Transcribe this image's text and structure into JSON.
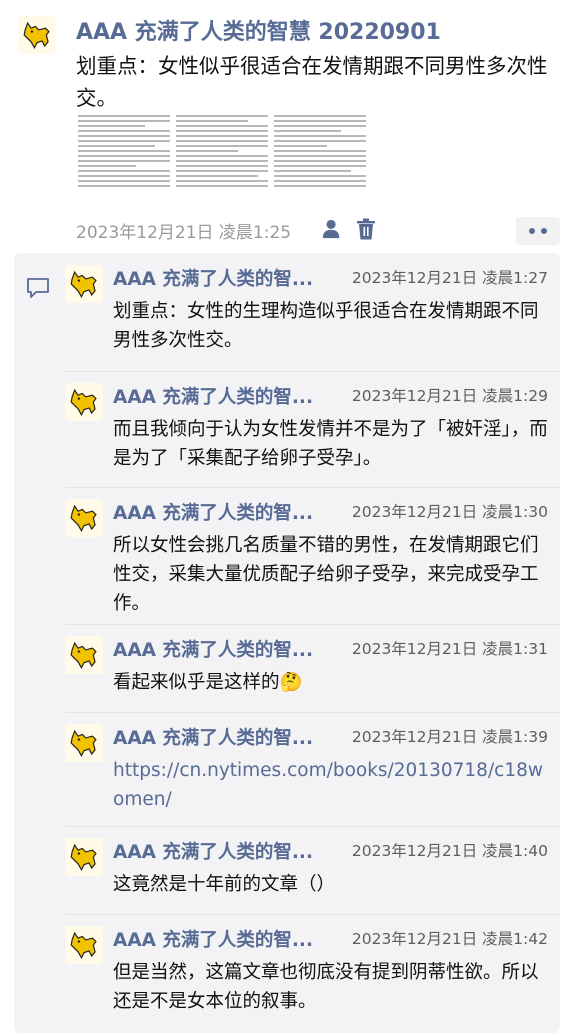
{
  "post": {
    "author": "AAA 充满了人类的智慧 20220901",
    "text": "划重点：女性似乎很适合在发情期跟不同男性多次性交。",
    "time": "2023年12月21日 凌晨1:25"
  },
  "comments": [
    {
      "name": "AAA 充满了人类的智...",
      "time": "2023年12月21日 凌晨1:27",
      "text": "划重点：女性的生理构造似乎很适合在发情期跟不同男性多次性交。"
    },
    {
      "name": "AAA 充满了人类的智...",
      "time": "2023年12月21日 凌晨1:29",
      "text": "而且我倾向于认为女性发情并不是为了「被奸淫」，而是为了「采集配子给卵子受孕」。"
    },
    {
      "name": "AAA 充满了人类的智...",
      "time": "2023年12月21日 凌晨1:30",
      "text": "所以女性会挑几名质量不错的男性，在发情期跟它们性交，采集大量优质配子给卵子受孕，来完成受孕工作。"
    },
    {
      "name": "AAA 充满了人类的智...",
      "time": "2023年12月21日 凌晨1:31",
      "text": "看起来似乎是这样的🤔"
    },
    {
      "name": "AAA 充满了人类的智...",
      "time": "2023年12月21日 凌晨1:39",
      "text": "https://cn.nytimes.com/books/20130718/c18women/"
    },
    {
      "name": "AAA 充满了人类的智...",
      "time": "2023年12月21日 凌晨1:40",
      "text": "这竟然是十年前的文章（）"
    },
    {
      "name": "AAA 充满了人类的智...",
      "time": "2023年12月21日 凌晨1:42",
      "text": "但是当然，这篇文章也彻底没有提到阴蒂性欲。所以还是不是女本位的叙事。"
    }
  ]
}
